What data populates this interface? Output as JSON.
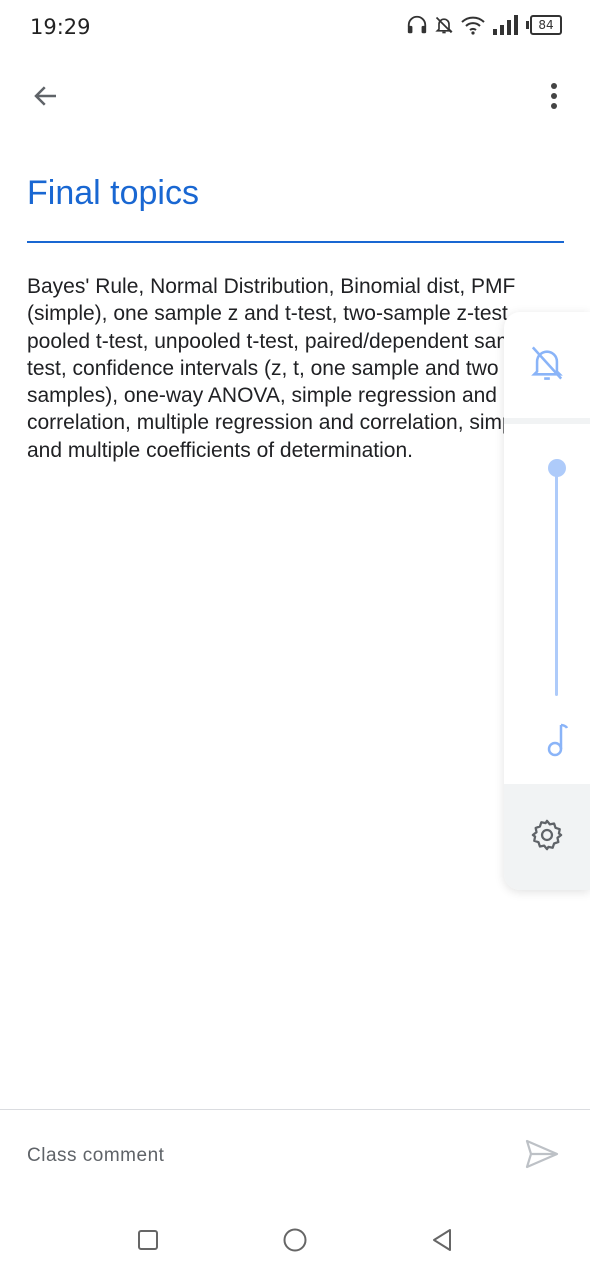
{
  "status_bar": {
    "time": "19:29",
    "battery": "84",
    "icons": [
      "headphones-icon",
      "bell-muted-icon",
      "wifi-icon",
      "signal-icon",
      "battery-icon"
    ]
  },
  "top_bar": {
    "back_icon": "arrow-left-icon",
    "more_icon": "more-vertical-icon"
  },
  "post": {
    "title": "Final topics",
    "description": "Bayes' Rule, Normal Distribution, Binomial dist,  PMF (simple), one sample z and t-test, two-sample z-test, pooled t-test, unpooled t-test, paired/dependent sample t-test, confidence intervals (z, t, one sample and two samples),  one-way ANOVA, simple regression and correlation, multiple regression and correlation, simple and multiple coefficients of determination."
  },
  "volume_panel": {
    "ringer_icon": "bell-off-icon",
    "media_icon": "music-note-icon",
    "settings_icon": "gear-icon",
    "media_level": 1.0
  },
  "comment": {
    "placeholder": "Class comment",
    "value": "",
    "send_icon": "send-icon"
  },
  "nav_bar": {
    "items": [
      "recents-square-icon",
      "home-circle-icon",
      "back-triangle-icon"
    ]
  },
  "colors": {
    "accent": "#1967d2",
    "volume_accent": "#aecbfa",
    "text": "#202124",
    "secondary_text": "#5f6368"
  }
}
